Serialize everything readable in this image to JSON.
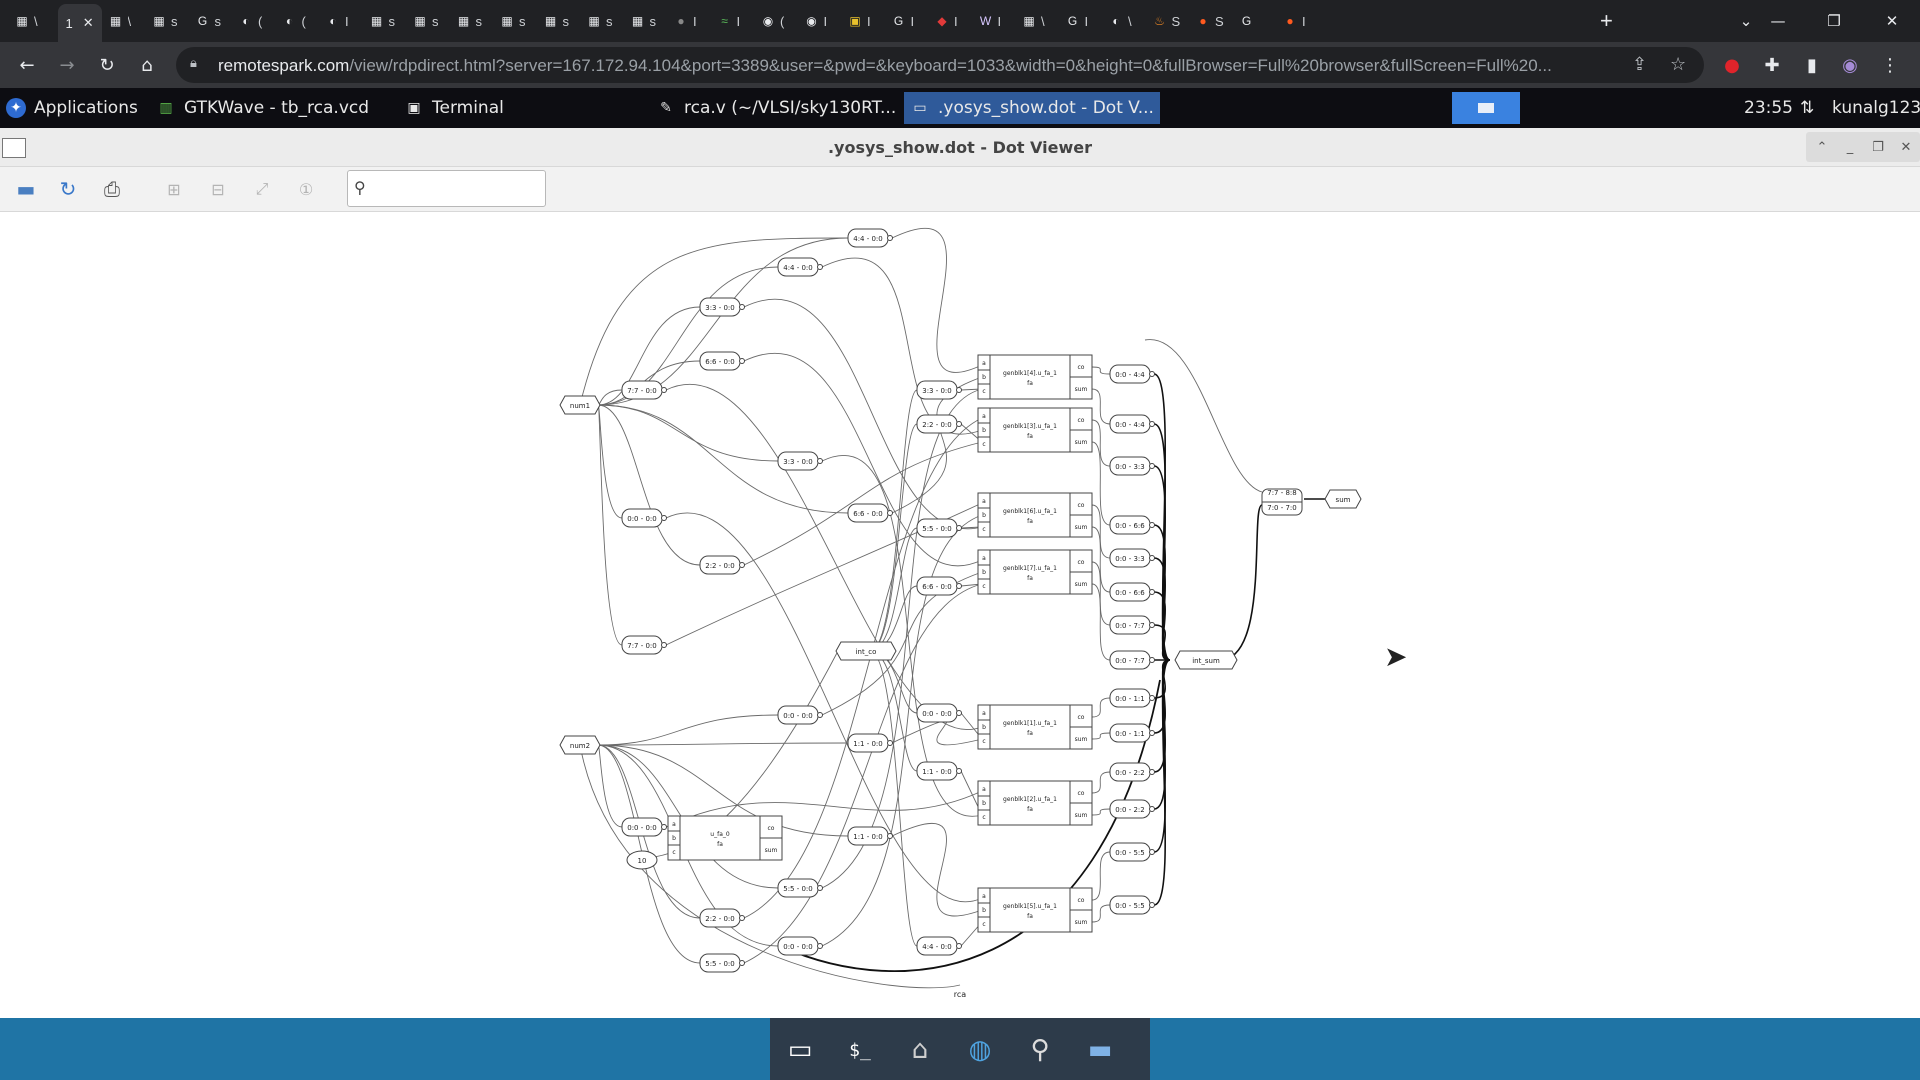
{
  "browser": {
    "tabs": [
      {
        "label": "\\",
        "icon": "doc-icon"
      },
      {
        "label": "1",
        "icon": "active-tab",
        "active": true,
        "close": "✕"
      },
      {
        "label": "\\",
        "icon": "doc-icon"
      },
      {
        "label": "s",
        "icon": "doc-icon"
      },
      {
        "label": "s",
        "icon": "google-icon"
      },
      {
        "label": "(",
        "icon": "globe-icon"
      },
      {
        "label": "(",
        "icon": "globe-icon"
      },
      {
        "label": "I",
        "icon": "globe-icon"
      },
      {
        "label": "s",
        "icon": "doc-icon"
      },
      {
        "label": "s",
        "icon": "doc-icon"
      },
      {
        "label": "s",
        "icon": "doc-icon"
      },
      {
        "label": "s",
        "icon": "doc-icon"
      },
      {
        "label": "s",
        "icon": "doc-icon"
      },
      {
        "label": "s",
        "icon": "doc-icon"
      },
      {
        "label": "s",
        "icon": "doc-icon"
      },
      {
        "label": "I",
        "icon": "dark-globe-icon"
      },
      {
        "label": "I",
        "icon": "green-icon"
      },
      {
        "label": "(",
        "icon": "github-icon"
      },
      {
        "label": "I",
        "icon": "github-icon"
      },
      {
        "label": "I",
        "icon": "yellow-icon"
      },
      {
        "label": "I",
        "icon": "google-icon"
      },
      {
        "label": "I",
        "icon": "red-icon"
      },
      {
        "label": "I",
        "icon": "w-icon"
      },
      {
        "label": "\\",
        "icon": "doc-icon"
      },
      {
        "label": "I",
        "icon": "google-icon"
      },
      {
        "label": "\\",
        "icon": "globe-icon"
      },
      {
        "label": "S",
        "icon": "fire-icon"
      },
      {
        "label": "S",
        "icon": "reddit-icon"
      },
      {
        "label": "",
        "icon": "google-icon"
      },
      {
        "label": "I",
        "icon": "reddit-icon"
      }
    ],
    "new_tab": "+",
    "url_host": "remotespark.com",
    "url_rest": "/view/rdpdirect.html?server=167.172.94.104&port=3389&user=&pwd=&keyboard=1033&width=0&height=0&fullBrowser=Full%20browser&fullScreen=Full%20..."
  },
  "panel": {
    "applications": "Applications",
    "tasks": [
      {
        "label": "GTKWave - tb_rca.vcd",
        "icon": "gtkwave-icon"
      },
      {
        "label": "Terminal",
        "icon": "terminal-icon"
      },
      {
        "label": "rca.v (~/VLSI/sky130RT...",
        "icon": "editor-icon"
      },
      {
        "label": ".yosys_show.dot - Dot V...",
        "icon": "window-icon",
        "active": true
      }
    ],
    "clock": "23:55",
    "user": "kunalg123"
  },
  "window": {
    "title": ".yosys_show.dot - Dot Viewer",
    "search_placeholder": ""
  },
  "graph": {
    "inputs": [
      "num1",
      "num2"
    ],
    "outputs": [
      "sum"
    ],
    "internal": [
      "int_co",
      "int_sum"
    ],
    "const": "10",
    "caption": "rca",
    "cells": [
      {
        "name": "genblk1[4].u_fa_1",
        "type": "fa"
      },
      {
        "name": "genblk1[3].u_fa_1",
        "type": "fa"
      },
      {
        "name": "genblk1[6].u_fa_1",
        "type": "fa"
      },
      {
        "name": "genblk1[7].u_fa_1",
        "type": "fa"
      },
      {
        "name": "genblk1[1].u_fa_1",
        "type": "fa"
      },
      {
        "name": "genblk1[2].u_fa_1",
        "type": "fa"
      },
      {
        "name": "genblk1[5].u_fa_1",
        "type": "fa"
      },
      {
        "name": "u_fa_0",
        "type": "fa"
      }
    ],
    "ports_in": [
      "a",
      "b",
      "c"
    ],
    "ports_out": [
      "co",
      "sum"
    ],
    "slices_left": [
      "4:4 - 0:0",
      "4:4 - 0:0",
      "3:3 - 0:0",
      "6:6 - 0:0",
      "7:7 - 0:0",
      "3:3 - 0:0",
      "0:0 - 0:0",
      "6:6 - 0:0",
      "2:2 - 0:0",
      "7:7 - 0:0",
      "0:0 - 0:0",
      "1:1 - 0:0",
      "0:0 - 0:0",
      "1:1 - 0:0",
      "5:5 - 0:0",
      "2:2 - 0:0",
      "0:0 - 0:0",
      "5:5 - 0:0"
    ],
    "slices_mid": [
      "3:3 - 0:0",
      "2:2 - 0:0",
      "5:5 - 0:0",
      "6:6 - 0:0",
      "0:0 - 0:0",
      "1:1 - 0:0",
      "4:4 - 0:0"
    ],
    "slices_right": [
      "0:0 - 4:4",
      "0:0 - 4:4",
      "0:0 - 3:3",
      "0:0 - 6:6",
      "0:0 - 3:3",
      "0:0 - 6:6",
      "0:0 - 7:7",
      "0:0 - 7:7",
      "0:0 - 1:1",
      "0:0 - 1:1",
      "0:0 - 2:2",
      "0:0 - 2:2",
      "0:0 - 5:5",
      "0:0 - 5:5"
    ],
    "concat": [
      "7:7 - 8:8",
      "7:0 - 7:0"
    ]
  }
}
